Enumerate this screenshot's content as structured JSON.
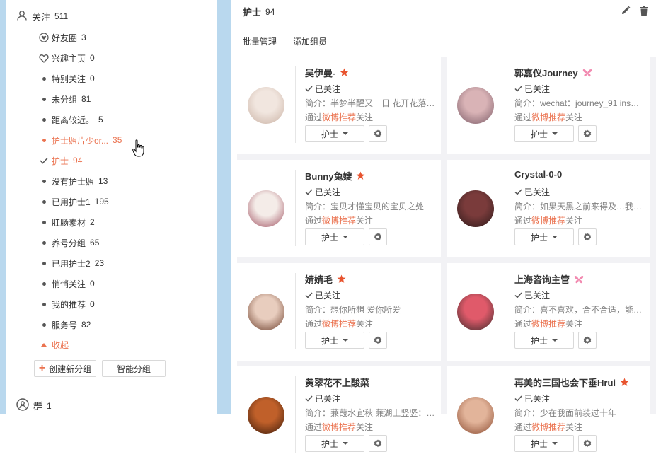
{
  "sidebar": {
    "header": {
      "label": "关注",
      "count": "511"
    },
    "groups": [
      {
        "label": "好友圈",
        "count": "3",
        "marker": "heart-circle"
      },
      {
        "label": "兴趣主页",
        "count": "0",
        "marker": "heart-outline"
      },
      {
        "label": "特别关注",
        "count": "0",
        "marker": "dot"
      },
      {
        "label": "未分组",
        "count": "81",
        "marker": "dot"
      },
      {
        "label": "距离较近。",
        "count": "5",
        "marker": "dot"
      },
      {
        "label": "护士照片少or...",
        "count": "35",
        "marker": "dot",
        "state": "hover"
      },
      {
        "label": "护士",
        "count": "94",
        "marker": "check",
        "state": "selected"
      },
      {
        "label": "没有护士照",
        "count": "13",
        "marker": "dot"
      },
      {
        "label": "已用护士1",
        "count": "195",
        "marker": "dot"
      },
      {
        "label": "肛肠素材",
        "count": "2",
        "marker": "dot"
      },
      {
        "label": "养号分组",
        "count": "65",
        "marker": "dot"
      },
      {
        "label": "已用护士2",
        "count": "23",
        "marker": "dot"
      },
      {
        "label": "悄悄关注",
        "count": "0",
        "marker": "dot"
      },
      {
        "label": "我的推荐",
        "count": "0",
        "marker": "dot"
      },
      {
        "label": "服务号",
        "count": "82",
        "marker": "dot"
      }
    ],
    "collapse_label": "收起",
    "create_group_label": "创建新分组",
    "smart_group_label": "智能分组",
    "group_chat": {
      "label": "群",
      "count": "1"
    }
  },
  "main": {
    "title": "护士",
    "count": "94",
    "subtabs": [
      "批量管理",
      "添加组员"
    ]
  },
  "cards": [
    {
      "name": "吴伊曼-",
      "badge": "star",
      "followed": "已关注",
      "intro": "简介：半梦半醒又一日 花开花落年…",
      "via_prefix": "通过",
      "via_rec": "微博推荐",
      "via_suffix": "关注",
      "tag": "护士",
      "avatar_colors": [
        "#f1e6df",
        "#c9b1a3"
      ]
    },
    {
      "name": "郭嘉仪Journey",
      "badge": "butterfly",
      "followed": "已关注",
      "intro": "简介：wechat：journey_91 ins：…",
      "via_prefix": "通过",
      "via_rec": "微博推荐",
      "via_suffix": "关注",
      "tag": "护士",
      "avatar_colors": [
        "#d9b3b6",
        "#7a5a66"
      ]
    },
    {
      "name": "Bunny兔嫂",
      "badge": "star",
      "followed": "已关注",
      "intro": "简介：宝贝才懂宝贝的宝贝之处",
      "via_prefix": "通过",
      "via_rec": "微博推荐",
      "via_suffix": "关注",
      "tag": "护士",
      "avatar_colors": [
        "#f4ece8",
        "#a05060"
      ]
    },
    {
      "name": "Crystal-0-0",
      "badge": "",
      "followed": "已关注",
      "intro": "简介：如果天黑之前来得及…我要…",
      "via_prefix": "通过",
      "via_rec": "微博推荐",
      "via_suffix": "关注",
      "tag": "护士",
      "avatar_colors": [
        "#7a3b3b",
        "#2c1a1a"
      ]
    },
    {
      "name": "婧婧毛",
      "badge": "star",
      "followed": "已关注",
      "intro": "简介：想你所想 爱你所爱",
      "via_prefix": "通过",
      "via_rec": "微博推荐",
      "via_suffix": "关注",
      "tag": "护士",
      "avatar_colors": [
        "#e8cdbe",
        "#6b3d2a"
      ]
    },
    {
      "name": "上海咨询主管",
      "badge": "butterfly",
      "followed": "已关注",
      "intro": "简介：喜不喜欢，合不合适，能不…",
      "via_prefix": "通过",
      "via_rec": "微博推荐",
      "via_suffix": "关注",
      "tag": "护士",
      "avatar_colors": [
        "#e05a6a",
        "#3a2a2a"
      ]
    },
    {
      "name": "黄翠花不上酸菜",
      "badge": "",
      "followed": "已关注",
      "intro": "简介：蒹葭水宜秋 蒹湖上竖竖：当…",
      "via_prefix": "通过",
      "via_rec": "微博推荐",
      "via_suffix": "关注",
      "tag": "护士",
      "avatar_colors": [
        "#c0602a",
        "#3a1a0a"
      ]
    },
    {
      "name": "再美的三国也会下垂Hrui",
      "badge": "star",
      "followed": "已关注",
      "intro": "简介：少在我面前装过十年",
      "via_prefix": "通过",
      "via_rec": "微博推荐",
      "via_suffix": "关注",
      "tag": "护士",
      "avatar_colors": [
        "#e2b49a",
        "#8a4a30"
      ]
    }
  ],
  "colors": {
    "accent": "#eb7350",
    "sidebar_strip": "#b9d8ee",
    "grid_bg": "#f2f2f5",
    "badge_butterfly": "#f28ab0"
  }
}
